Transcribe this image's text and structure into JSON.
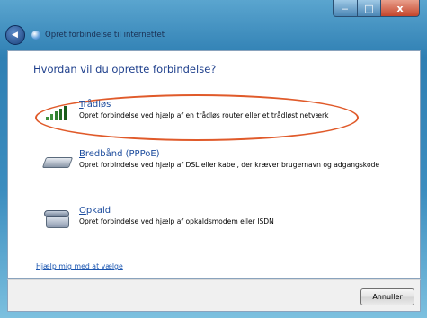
{
  "window": {
    "minimize_glyph": "‒",
    "maximize_glyph": "□",
    "close_glyph": "x"
  },
  "nav": {
    "back_glyph": "◀",
    "title": "Opret forbindelse til internettet"
  },
  "main": {
    "heading": "Hvordan vil du oprette forbindelse?",
    "options": [
      {
        "mnemonic": "T",
        "title_rest": "rådløs",
        "description": "Opret forbindelse ved hjælp af en trådløs router eller et trådløst netværk",
        "icon": "wireless-signal-icon",
        "highlighted": true
      },
      {
        "mnemonic": "B",
        "title_rest": "redbånd (PPPoE)",
        "description": "Opret forbindelse ved hjælp af DSL eller kabel, der kræver brugernavn og adgangskode",
        "icon": "broadband-modem-icon",
        "highlighted": false
      },
      {
        "mnemonic": "O",
        "title_rest": "pkald",
        "description": "Opret forbindelse ved hjælp af opkaldsmodem eller ISDN",
        "icon": "dialup-phone-icon",
        "highlighted": false
      }
    ],
    "help_link": "Hjælp mig med at vælge"
  },
  "footer": {
    "cancel_label": "Annuller"
  },
  "colors": {
    "highlight": "#e05a2a",
    "link": "#1a55b0",
    "heading": "#1e3f8c"
  }
}
